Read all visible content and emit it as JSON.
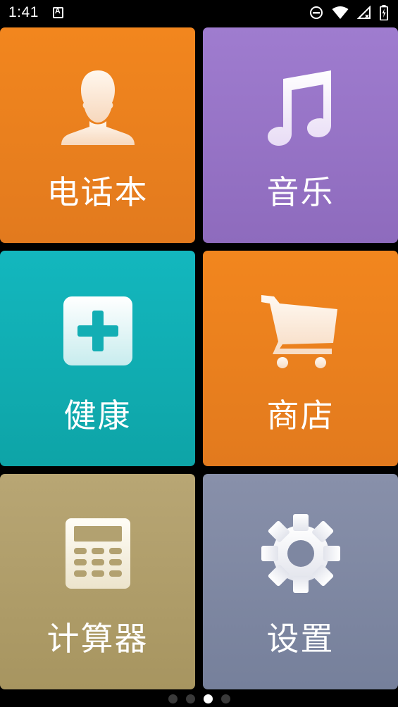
{
  "status_bar": {
    "time": "1:41",
    "icons": [
      "keyboard-a-icon",
      "do-not-disturb-icon",
      "wifi-icon",
      "signal-icon",
      "battery-charging-icon"
    ]
  },
  "tiles": [
    {
      "label": "电话本",
      "icon": "contact-person-icon",
      "color": "#f2861e"
    },
    {
      "label": "音乐",
      "icon": "music-note-icon",
      "color": "#9f7ccf"
    },
    {
      "label": "健康",
      "icon": "health-plus-icon",
      "color": "#13b7be"
    },
    {
      "label": "商店",
      "icon": "shopping-cart-icon",
      "color": "#f2861e"
    },
    {
      "label": "计算器",
      "icon": "calculator-icon",
      "color": "#b8a674"
    },
    {
      "label": "设置",
      "icon": "settings-gear-icon",
      "color": "#8890aa"
    }
  ],
  "pager": {
    "total_pages": 4,
    "active_page": 3
  }
}
